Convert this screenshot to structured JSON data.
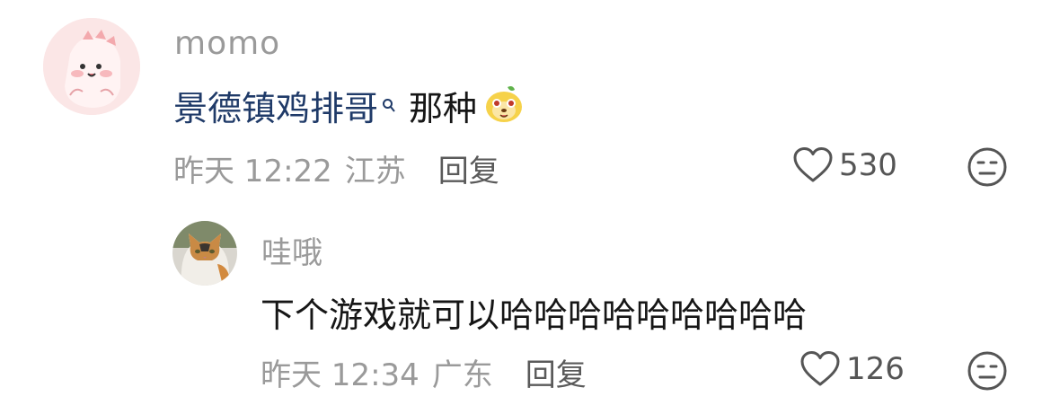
{
  "comments": [
    {
      "username": "momo",
      "text_hashtag": "景德镇鸡排哥",
      "text_rest": "那种",
      "emoji": "face-emoji-icon",
      "time": "昨天 12:22",
      "location": "江苏",
      "reply_label": "回复",
      "likes": "530",
      "avatar": "pink-dino-avatar"
    },
    {
      "username": "哇哦",
      "text": "下个游戏就可以哈哈哈哈哈哈哈哈哈",
      "time": "昨天 12:34",
      "location": "广东",
      "reply_label": "回复",
      "likes": "126",
      "avatar": "cat-avatar"
    }
  ],
  "colors": {
    "meta_gray": "#9a9a9a",
    "hashtag": "#1f3a68",
    "text": "#161616"
  }
}
